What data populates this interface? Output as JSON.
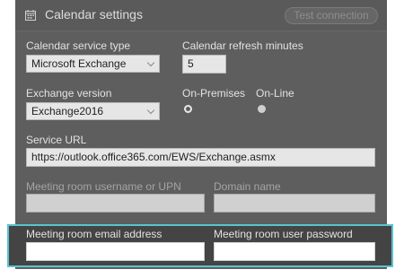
{
  "header": {
    "title": "Calendar settings",
    "icon": "calendar-icon",
    "test_button_label": "Test connection"
  },
  "fields": {
    "service_type": {
      "label": "Calendar service type",
      "value": "Microsoft Exchange"
    },
    "refresh": {
      "label": "Calendar refresh minutes",
      "value": "5"
    },
    "exchange_version": {
      "label": "Exchange version",
      "value": "Exchange2016"
    },
    "deployment": {
      "on_premises_label": "On-Premises",
      "online_label": "On-Line",
      "selected": "On-Premises"
    },
    "service_url": {
      "label": "Service URL",
      "value": "https://outlook.office365.com/EWS/Exchange.asmx"
    },
    "room_username": {
      "label": "Meeting room username or UPN",
      "value": ""
    },
    "domain": {
      "label": "Domain name",
      "value": ""
    },
    "room_email": {
      "label": "Meeting room email address",
      "value": ""
    },
    "room_password": {
      "label": "Meeting room user password",
      "value": ""
    }
  },
  "colors": {
    "panel_bg": "#5e5e5e",
    "highlight_border": "#59c3cf"
  }
}
